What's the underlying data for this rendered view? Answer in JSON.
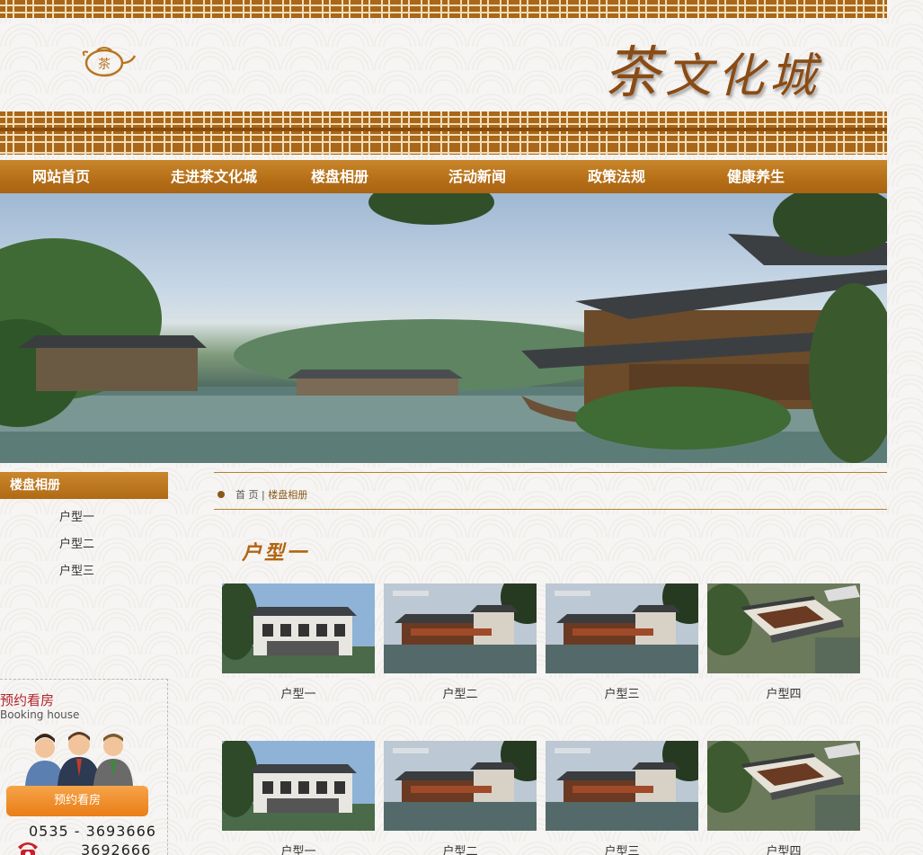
{
  "header": {
    "logo_text": "茶",
    "brand_first": "茶",
    "brand_rest": "文化城"
  },
  "nav": [
    "网站首页",
    "走进茶文化城",
    "楼盘相册",
    "活动新闻",
    "政策法规",
    "健康养生"
  ],
  "sidebar": {
    "title": "楼盘相册",
    "links": [
      "户型一",
      "户型二",
      "户型三"
    ],
    "booking": {
      "title": "预约看房",
      "subtitle": "Booking house",
      "button": "预约看房",
      "phone1": "0535 - 3693666",
      "phone2": "3692666"
    }
  },
  "breadcrumb": {
    "home": "首 页",
    "sep": " | ",
    "current": "楼盘相册"
  },
  "section_title": "户型一",
  "gallery": [
    {
      "caption": "户型一",
      "image": "modern-villa"
    },
    {
      "caption": "户型二",
      "image": "riverside-complex"
    },
    {
      "caption": "户型三",
      "image": "riverside-complex"
    },
    {
      "caption": "户型四",
      "image": "aerial-courtyard"
    },
    {
      "caption": "户型一",
      "image": "modern-villa"
    },
    {
      "caption": "户型二",
      "image": "riverside-complex"
    },
    {
      "caption": "户型三",
      "image": "riverside-complex"
    },
    {
      "caption": "户型四",
      "image": "aerial-courtyard"
    }
  ],
  "colors": {
    "accent": "#b56e17",
    "title": "#b26512",
    "booking": "#b3242c",
    "button": "#e97d16"
  }
}
